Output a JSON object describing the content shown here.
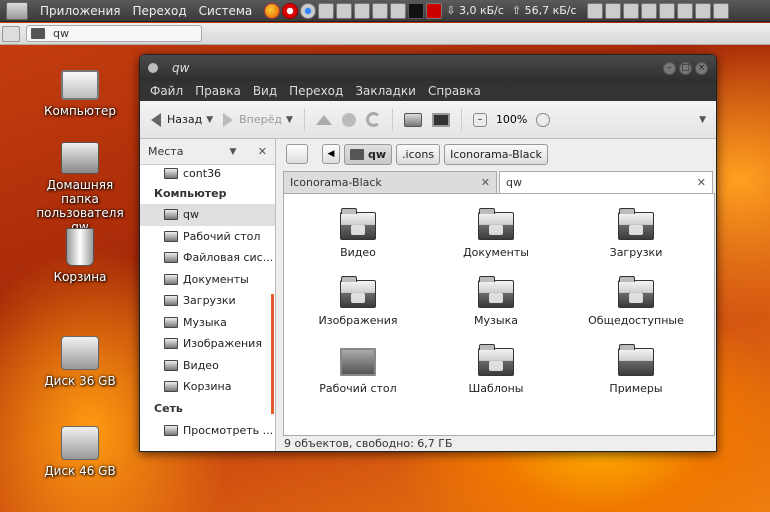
{
  "top_panel": {
    "menus": [
      "Приложения",
      "Переход",
      "Система"
    ],
    "net_down": "3,0 кБ/с",
    "net_up": "56,7 кБ/с"
  },
  "address_strip": {
    "field_text": "qw"
  },
  "desktop": {
    "icons": [
      {
        "label": "Компьютер"
      },
      {
        "label": "Домашняя папка пользователя qw"
      },
      {
        "label": "Корзина"
      },
      {
        "label": "Диск 36 GB"
      },
      {
        "label": "Диск 46 GB"
      }
    ]
  },
  "window": {
    "title": "qw",
    "menu": [
      "Файл",
      "Правка",
      "Вид",
      "Переход",
      "Закладки",
      "Справка"
    ],
    "toolbar": {
      "back": "Назад",
      "forward": "Вперёд",
      "zoom": "100%"
    },
    "sidebar": {
      "header": "Места",
      "top_item": "cont36",
      "cat_computer": "Компьютер",
      "items": [
        "qw",
        "Рабочий стол",
        "Файловая сис...",
        "Документы",
        "Загрузки",
        "Музыка",
        "Изображения",
        "Видео",
        "Корзина"
      ],
      "cat_network": "Сеть",
      "network_item": "Просмотреть ..."
    },
    "location": {
      "crumbs": [
        "qw",
        ".icons",
        "Iconorama-Black"
      ]
    },
    "tabs": [
      "Iconorama-Black",
      "qw"
    ],
    "files": [
      "Видео",
      "Документы",
      "Загрузки",
      "Изображения",
      "Музыка",
      "Общедоступные",
      "Рабочий стол",
      "Шаблоны",
      "Примеры"
    ],
    "status": "9 объектов, свободно: 6,7 ГБ"
  }
}
